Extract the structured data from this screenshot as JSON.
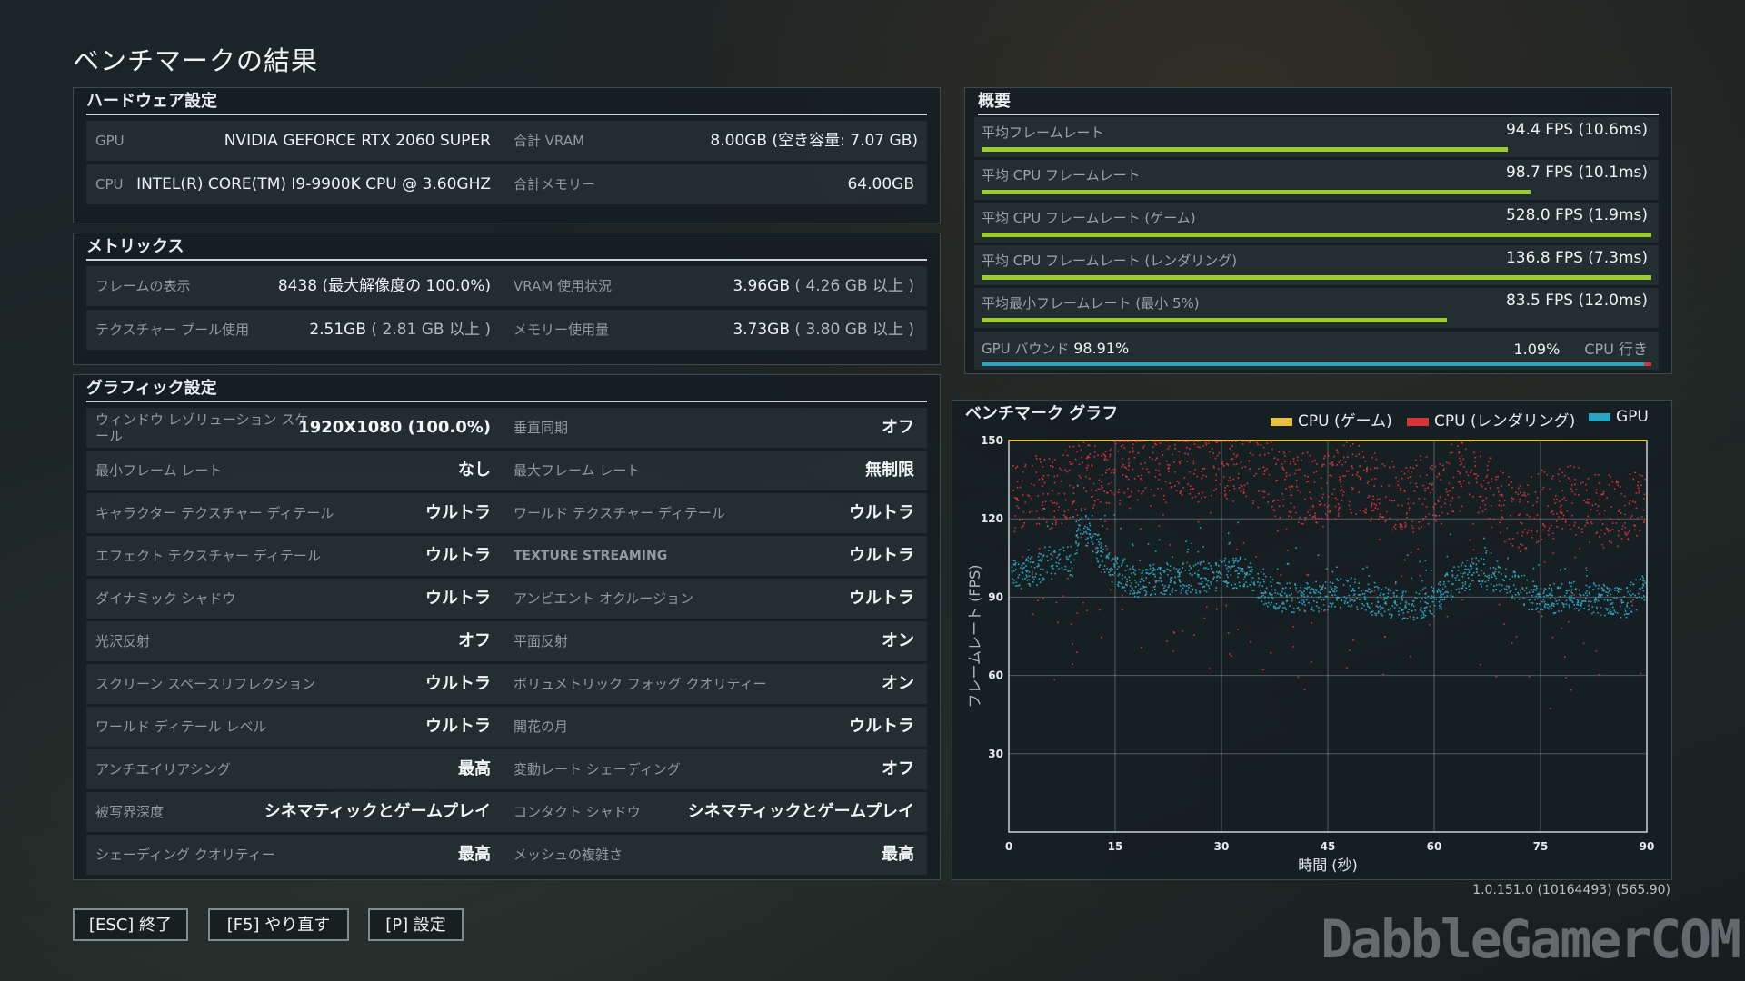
{
  "page_title": "ベンチマークの結果",
  "hardware": {
    "header": "ハードウェア設定",
    "gpu_label": "GPU",
    "gpu_value": "NVIDIA GEFORCE RTX 2060 SUPER",
    "vram_label": "合計 VRAM",
    "vram_value": "8.00GB (空き容量: 7.07 GB)",
    "cpu_label": "CPU",
    "cpu_value": "INTEL(R) CORE(TM) I9-9900K CPU @ 3.60GHZ",
    "mem_label": "合計メモリー",
    "mem_value": "64.00GB"
  },
  "metrics": {
    "header": "メトリックス",
    "frames_label": "フレームの表示",
    "frames_value": "8438 (最大解像度の 100.0%)",
    "vram_use_label": "VRAM 使用状況",
    "vram_use_value": "3.96GB",
    "vram_use_sub": "( 4.26 GB 以上 )",
    "pool_label": "テクスチャー プール使用",
    "pool_value": "2.51GB",
    "pool_sub": "( 2.81 GB 以上 )",
    "mem_use_label": "メモリー使用量",
    "mem_use_value": "3.73GB",
    "mem_use_sub": "( 3.80 GB 以上 )"
  },
  "graphics": {
    "header": "グラフィック設定",
    "rows": [
      {
        "l1": "ウィンドウ レゾリューション スケール",
        "v1": "1920X1080 (100.0%)",
        "l2": "垂直同期",
        "v2": "オフ"
      },
      {
        "l1": "最小フレーム レート",
        "v1": "なし",
        "l2": "最大フレーム レート",
        "v2": "無制限"
      },
      {
        "l1": "キャラクター テクスチャー ディテール",
        "v1": "ウルトラ",
        "l2": "ワールド テクスチャー ディテール",
        "v2": "ウルトラ"
      },
      {
        "l1": "エフェクト テクスチャー ディテール",
        "v1": "ウルトラ",
        "l2": "TEXTURE STREAMING",
        "v2": "ウルトラ"
      },
      {
        "l1": "ダイナミック シャドウ",
        "v1": "ウルトラ",
        "l2": "アンビエント オクルージョン",
        "v2": "ウルトラ"
      },
      {
        "l1": "光沢反射",
        "v1": "オフ",
        "l2": "平面反射",
        "v2": "オン"
      },
      {
        "l1": "スクリーン スペースリフレクション",
        "v1": "ウルトラ",
        "l2": "ボリュメトリック フォッグ クオリティー",
        "v2": "オン"
      },
      {
        "l1": "ワールド ディテール レベル",
        "v1": "ウルトラ",
        "l2": "開花の月",
        "v2": "ウルトラ"
      },
      {
        "l1": "アンチエイリアシング",
        "v1": "最高",
        "l2": "変動レート シェーディング",
        "v2": "オフ"
      },
      {
        "l1": "被写界深度",
        "v1": "シネマティックとゲームプレイ",
        "l2": "コンタクト シャドウ",
        "v2": "シネマティックとゲームプレイ"
      },
      {
        "l1": "シェーディング クオリティー",
        "v1": "最高",
        "l2": "メッシュの複雑さ",
        "v2": "最高"
      }
    ]
  },
  "summary": {
    "header": "概要",
    "bars": [
      {
        "label": "平均フレームレート",
        "value": "94.4 FPS (10.6ms)",
        "fill": 0.785
      },
      {
        "label": "平均 CPU フレームレート",
        "value": "98.7 FPS (10.1ms)",
        "fill": 0.82
      },
      {
        "label": "平均 CPU フレームレート (ゲーム)",
        "value": "528.0 FPS (1.9ms)",
        "fill": 1.0
      },
      {
        "label": "平均 CPU フレームレート (レンダリング)",
        "value": "136.8 FPS (7.3ms)",
        "fill": 1.0
      },
      {
        "label": "平均最小フレームレート (最小 5%)",
        "value": "83.5 FPS (12.0ms)",
        "fill": 0.695
      }
    ],
    "bound_left_label": "GPU バウンド",
    "bound_left_value": "98.91%",
    "bound_right_value": "1.09%",
    "bound_right_label": "CPU 行き",
    "bound_fraction": 0.9891
  },
  "chart_data": {
    "type": "scatter",
    "title": "ベンチマーク グラフ",
    "xlabel": "時間 (秒)",
    "ylabel": "フレームレート (FPS)",
    "xlim": [
      0,
      90
    ],
    "ylim": [
      0,
      150
    ],
    "xticks": [
      0,
      15,
      30,
      45,
      60,
      75,
      90
    ],
    "yticks": [
      30,
      60,
      90,
      120,
      150
    ],
    "grid": true,
    "legend_position": "top",
    "series": [
      {
        "name": "CPU (ゲーム)",
        "color": "#e8c040",
        "x": [
          0,
          10,
          20,
          30,
          40,
          50,
          60,
          70,
          80,
          90
        ],
        "y": [
          150,
          150,
          150,
          150,
          150,
          150,
          150,
          150,
          150,
          150
        ]
      },
      {
        "name": "CPU (レンダリング)",
        "color": "#d8333a",
        "x": [
          0,
          3,
          6,
          9,
          12,
          15,
          18,
          21,
          24,
          27,
          30,
          33,
          36,
          39,
          42,
          45,
          48,
          51,
          54,
          57,
          60,
          63,
          66,
          69,
          72,
          75,
          78,
          81,
          84,
          87,
          90
        ],
        "y": [
          128,
          132,
          130,
          135,
          138,
          140,
          142,
          141,
          143,
          142,
          141,
          140,
          137,
          133,
          132,
          133,
          136,
          134,
          130,
          129,
          133,
          137,
          136,
          126,
          120,
          125,
          128,
          126,
          123,
          124,
          128
        ]
      },
      {
        "name": "GPU",
        "color": "#2aa6c0",
        "x": [
          0,
          3,
          6,
          9,
          10,
          12,
          15,
          18,
          21,
          24,
          27,
          30,
          33,
          36,
          39,
          42,
          45,
          48,
          51,
          54,
          57,
          60,
          63,
          66,
          69,
          72,
          75,
          78,
          81,
          84,
          87,
          90
        ],
        "y": [
          98,
          100,
          103,
          104,
          120,
          110,
          100,
          96,
          97,
          97,
          98,
          99,
          100,
          93,
          90,
          90,
          91,
          92,
          89,
          88,
          87,
          89,
          97,
          100,
          98,
          94,
          88,
          91,
          90,
          89,
          88,
          95
        ]
      }
    ]
  },
  "buttons": {
    "esc_label": "[ESC] 終了",
    "f5_label": "[F5] やり直す",
    "p_label": "[P] 設定"
  },
  "version": "1.0.151.0 (10164493) (565.90)",
  "watermark": "DabbleGamerCOM"
}
